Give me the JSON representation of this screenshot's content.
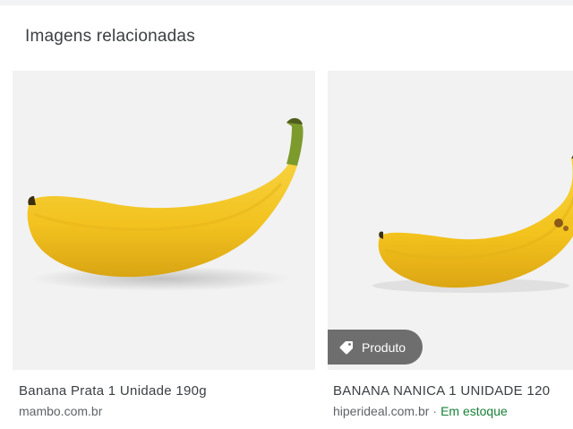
{
  "section": {
    "title": "Imagens relacionadas"
  },
  "cards": [
    {
      "title": "Banana Prata 1 Unidade 190g",
      "source": "mambo.com.br",
      "image_icon": "banana-image"
    },
    {
      "title": "BANANA NANICA 1 UNIDADE 120",
      "source": "hiperideal.com.br",
      "separator": "·",
      "availability": "Em estoque",
      "chip_label": "Produto",
      "chip_icon": "tag-icon",
      "image_icon": "banana-image"
    }
  ],
  "colors": {
    "background": "#ffffff",
    "thumb_bg": "#f2f2f2",
    "chip_bg": "#6e6e6e",
    "availability": "#188038"
  }
}
